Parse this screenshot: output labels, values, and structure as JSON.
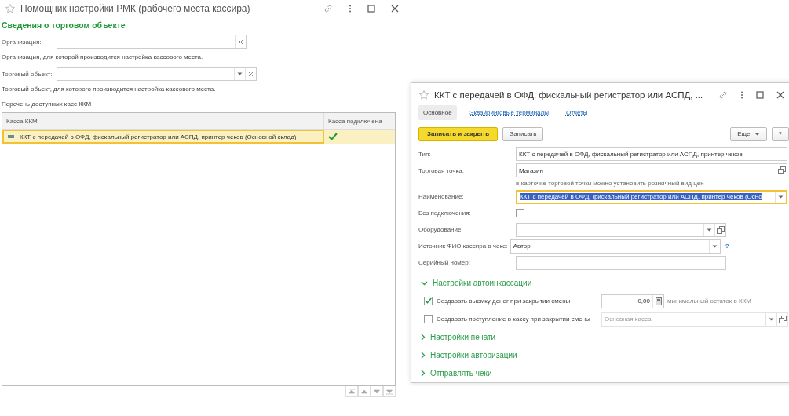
{
  "main_window": {
    "title": "Помощник настройки РМК (рабочего места кассира)",
    "section_title": "Сведения о торговом объекте",
    "fields": [
      {
        "label": "Организация:",
        "kind": "clear",
        "hint": "Организация, для которой производится настройка кассового места."
      },
      {
        "label": "Торговый объект:",
        "kind": "select_clear",
        "hint": "Торговый объект, для которого производится настройка кассового места."
      }
    ],
    "list_label": "Перечень доступных касс ККМ",
    "table": {
      "columns": [
        "Касса ККМ",
        "Касса подключена"
      ],
      "rows": [
        {
          "name": "ККТ с передачей в ОФД, фискальный регистратор или АСПД, принтер чеков (Основной склад)",
          "connected": true,
          "selected": true
        }
      ]
    }
  },
  "dialog": {
    "title": "ККТ с передачей в ОФД, фискальный регистратор или АСПД, ...",
    "tabs": [
      {
        "label": "Основное",
        "selected": true
      },
      {
        "label": "Эквайринговые терминалы",
        "selected": false
      },
      {
        "label": "Отчеты",
        "selected": false
      }
    ],
    "buttons": [
      {
        "label": "Записать и закрыть",
        "kind": "primary"
      },
      {
        "label": "Записать",
        "kind": "normal"
      }
    ],
    "more_button": "Еще",
    "help_button": "?",
    "fields": [
      {
        "label": "Тип:",
        "kind": "text",
        "value": "ККТ с передачей в ОФД, фискальный регистратор или АСПД, принтер чеков",
        "wide": true,
        "focused": false
      },
      {
        "label": "Торговая точка:",
        "kind": "open",
        "value": "Магазин",
        "wide": true,
        "focused": false,
        "hint": "в карточке торговой точки можно установить розничный вид цен"
      },
      {
        "label": "Наименование:",
        "kind": "select",
        "value": "ККТ с передачей в ОФД, фискальный регистратор или АСПД, принтер чеков (Осно",
        "wide": true,
        "focused": true,
        "text_selected": true
      },
      {
        "label": "Без подключения:",
        "kind": "checkbox",
        "checked": false
      },
      {
        "label": "Оборудование:",
        "kind": "select_open",
        "wide": false,
        "focused": false
      },
      {
        "label": "Источник ФИО кассира в чеке:",
        "kind": "select",
        "value": "Автор",
        "wide": false,
        "focused": false,
        "help": "?"
      },
      {
        "label": "Серийный номер:",
        "kind": "text",
        "wide": false,
        "focused": false
      }
    ],
    "sections": [
      {
        "title": "Настройки автоинкассации",
        "expanded": true,
        "options": [
          {
            "label": "Создавать выемку денег при закрытии смены",
            "checked": true,
            "kind": "number",
            "value": "0,00",
            "note": "минимальный остаток в ККМ",
            "disabled": false
          },
          {
            "label": "Создавать поступление в кассу при закрытии смены",
            "checked": false,
            "kind": "select",
            "value": "Основная касса",
            "disabled": true
          }
        ]
      },
      {
        "title": "Настройки печати",
        "expanded": false
      },
      {
        "title": "Настройки авторизации",
        "expanded": false
      },
      {
        "title": "Отправлять чеки",
        "expanded": false
      }
    ]
  }
}
